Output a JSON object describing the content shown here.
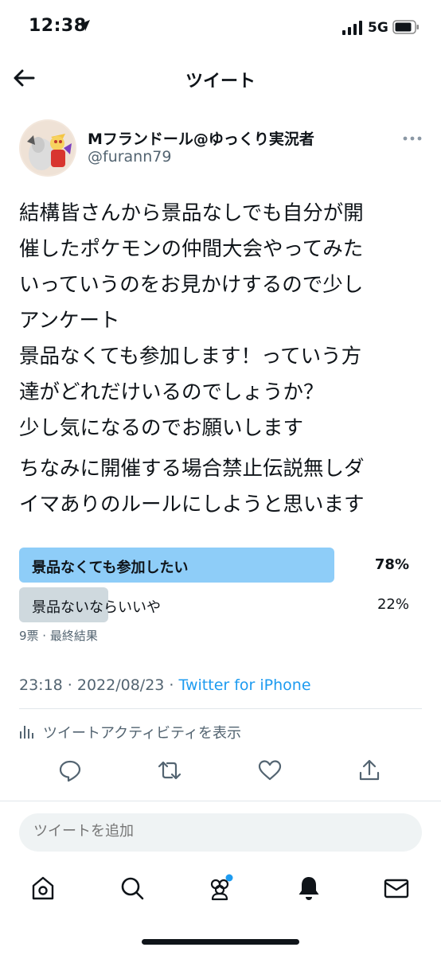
{
  "status_bar": {
    "time": "12:38",
    "network": "5G"
  },
  "header": {
    "title": "ツイート"
  },
  "author": {
    "name": "Mフランドール@ゆっくり実況者",
    "handle": "@furann79"
  },
  "tweet": {
    "paragraphs": [
      "結構皆さんから景品なしでも自分が開\n催したポケモンの仲間大会やってみた\nいっていうのをお見かけするので少し\nアンケート\n景品なくても参加します！っていう方\n達がどれだけいるのでしょうか？\n少し気になるのでお願いします",
      "ちなみに開催する場合禁止伝説無しダ\nイマありのルールにしようと思います"
    ]
  },
  "poll": {
    "options": [
      {
        "label": "景品なくても参加したい",
        "percent": "78%",
        "fraction": 0.78,
        "winner": true
      },
      {
        "label": "景品ないならいいや",
        "percent": "22%",
        "fraction": 0.22,
        "winner": false
      }
    ],
    "meta": "9票 · 最終結果",
    "colors": {
      "winner": "#8ecdf8",
      "other": "#cfd9de"
    }
  },
  "timestamp": {
    "time": "23:18 · 2022/08/23 · ",
    "source": "Twitter for iPhone"
  },
  "activity": {
    "label": "ツイートアクティビティを表示"
  },
  "actions": [
    "reply-icon",
    "retweet-icon",
    "like-icon",
    "share-icon"
  ],
  "reply_box": {
    "placeholder": "ツイートを追加"
  },
  "tabbar": {
    "items": [
      "home-icon",
      "search-icon",
      "communities-icon",
      "notifications-icon",
      "messages-icon"
    ]
  },
  "colors": {
    "accent": "#1d9bf0",
    "text": "#0f1419",
    "muted": "#536471"
  }
}
